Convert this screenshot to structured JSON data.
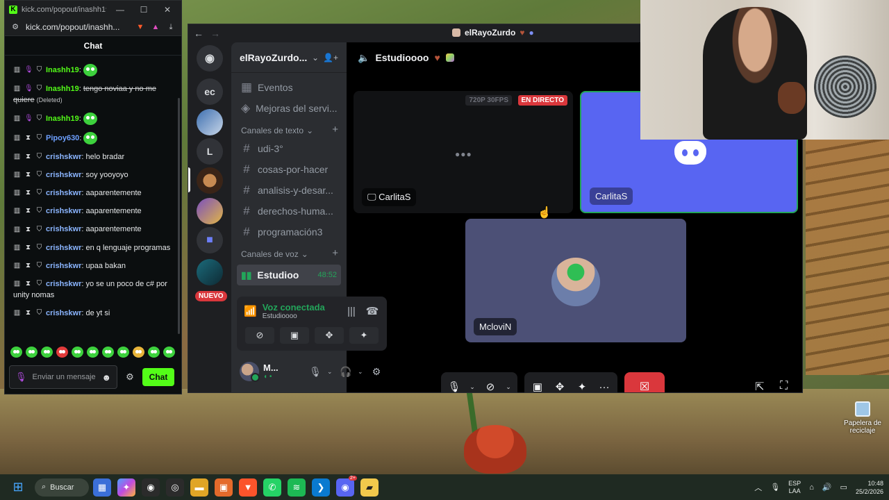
{
  "kick": {
    "tab_title": "kick.com/popout/inashh19/...",
    "url": "kick.com/popout/inashh...",
    "brave_count": "3",
    "header": "Chat",
    "messages": [
      {
        "user": "Inashh19",
        "text": "",
        "color": "#53fc18",
        "deleted": false,
        "emote": true
      },
      {
        "user": "Inashh19",
        "text": "tengo noviaa y no me quiere",
        "color": "#53fc18",
        "deleted": true,
        "note": "(Deleted)"
      },
      {
        "user": "Inashh19",
        "text": "",
        "color": "#53fc18",
        "deleted": false,
        "emote": true
      },
      {
        "user": "Pipoy630",
        "text": "",
        "color": "#6ea0ff",
        "deleted": false,
        "emote": true
      },
      {
        "user": "crishskwr",
        "text": "helo bradar",
        "color": "#8bb5ff"
      },
      {
        "user": "crishskwr",
        "text": "soy yooyoyo",
        "color": "#8bb5ff"
      },
      {
        "user": "crishskwr",
        "text": "aaparentemente",
        "color": "#8bb5ff"
      },
      {
        "user": "crishskwr",
        "text": "aaparentemente",
        "color": "#8bb5ff"
      },
      {
        "user": "crishskwr",
        "text": "aaparentemente",
        "color": "#8bb5ff"
      },
      {
        "user": "crishskwr",
        "text": "en q lenguaje programas",
        "color": "#8bb5ff"
      },
      {
        "user": "crishskwr",
        "text": "upaa bakan",
        "color": "#8bb5ff"
      },
      {
        "user": "crishskwr",
        "text": "yo se un poco de c# por unity nomas",
        "color": "#8bb5ff"
      },
      {
        "user": "crishskwr",
        "text": "de yt si",
        "color": "#8bb5ff"
      }
    ],
    "input_placeholder": "Enviar un mensaje",
    "send_label": "Chat"
  },
  "discord": {
    "window_title": "elRayoZurdo",
    "server_name": "elRayoZurdo...",
    "server_label_ec": "ec",
    "server_label_l": "L",
    "new_badge": "NUEVO",
    "menu_items": [
      "Eventos",
      "Mejoras del servi..."
    ],
    "text_category": "Canales de texto",
    "text_channels": [
      "udi-3°",
      "cosas-por-hacer",
      "analisis-y-desar...",
      "derechos-huma...",
      "programación3"
    ],
    "voice_category": "Canales de voz",
    "active_voice": {
      "name": "Estudioo",
      "time": "48:52"
    },
    "voice_status": "Voz conectada",
    "voice_channel_sub": "Estudioooo",
    "user_name": "M...",
    "stage_channel": "Estudioooo",
    "tiles": {
      "a_name": "CarlitaS",
      "a_quality": "720P 30FPS",
      "a_live": "EN DIRECTO",
      "b_name": "CarlitaS",
      "c_name": "McloviN"
    }
  },
  "desktop": {
    "recycle_label": "Papelera de reciclaje"
  },
  "taskbar": {
    "search_label": "Buscar",
    "lang_top": "ESP",
    "lang_bottom": "LAA",
    "time": "10:48",
    "date": "25/2/2026",
    "discord_badge": "2+"
  }
}
